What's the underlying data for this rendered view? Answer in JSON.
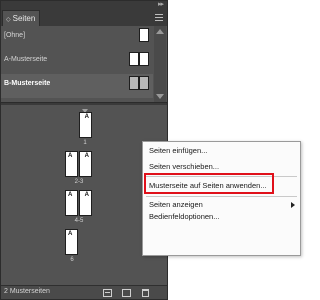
{
  "panel": {
    "tab_label": "Seiten",
    "tab_arrows": "◇",
    "collapse_arrows": "▸▸"
  },
  "masters": [
    {
      "label": "[Ohne]",
      "bold": false
    },
    {
      "label": "A-Musterseite",
      "bold": false
    },
    {
      "label": "B-Musterseite",
      "bold": true
    }
  ],
  "pages": [
    {
      "label": "1",
      "letters": [
        "A"
      ]
    },
    {
      "label": "2-3",
      "letters": [
        "A",
        "A"
      ]
    },
    {
      "label": "4-5",
      "letters": [
        "A",
        "A"
      ]
    },
    {
      "label": "6",
      "letters": [
        "A"
      ]
    }
  ],
  "footer": {
    "status": "2 Musterseiten"
  },
  "context_menu": {
    "items": [
      {
        "label": "Seiten einfügen..."
      },
      {
        "label": "Seiten verschieben..."
      },
      {
        "label": "Musterseite auf Seiten anwenden..."
      },
      {
        "label": "Seiten anzeigen"
      },
      {
        "label": "Bedienfeldoptionen..."
      }
    ]
  },
  "colors": {
    "highlight": "#e0101a",
    "panel_bg": "#535353"
  }
}
